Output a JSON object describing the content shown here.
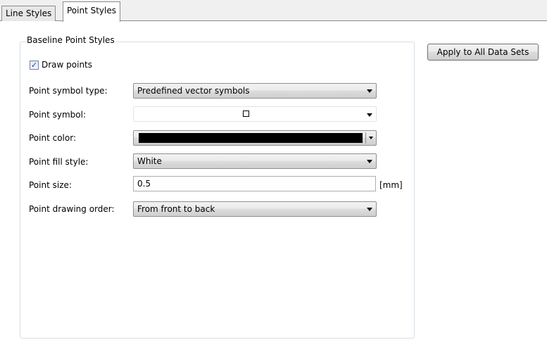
{
  "tabs": [
    {
      "label": "Line Styles",
      "active": false
    },
    {
      "label": "Point Styles",
      "active": true
    }
  ],
  "group": {
    "title": "Baseline Point Styles"
  },
  "draw_points": {
    "label": "Draw points",
    "checked": true
  },
  "fields": {
    "symbol_type": {
      "label": "Point symbol type:",
      "value": "Predefined vector symbols"
    },
    "symbol": {
      "label": "Point symbol:",
      "value": "hollow-square"
    },
    "color": {
      "label": "Point color:",
      "value": "#000000"
    },
    "fill_style": {
      "label": "Point fill style:",
      "value": "White"
    },
    "size": {
      "label": "Point size:",
      "value": "0.5",
      "unit": "[mm]"
    },
    "drawing_order": {
      "label": "Point drawing order:",
      "value": "From front to back"
    }
  },
  "apply_button": {
    "label": "Apply to All Data Sets"
  }
}
